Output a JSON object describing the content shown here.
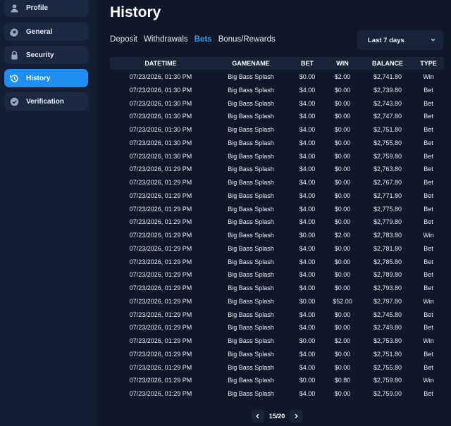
{
  "sidebar": {
    "items": [
      {
        "label": "Profile",
        "icon": "user-icon"
      },
      {
        "label": "General",
        "icon": "gear-icon"
      },
      {
        "label": "Security",
        "icon": "lock-icon"
      },
      {
        "label": "History",
        "icon": "history-icon",
        "active": true
      },
      {
        "label": "Verification",
        "icon": "check-badge-icon"
      }
    ]
  },
  "page": {
    "title": "History",
    "tabs": [
      "Deposit",
      "Withdrawals",
      "Bets",
      "Bonus/Rewards"
    ],
    "active_tab": "Bets",
    "range_select": "Last 7 days"
  },
  "table": {
    "headers": [
      "DATETIME",
      "GAMENAME",
      "BET",
      "WIN",
      "BALANCE",
      "TYPE"
    ],
    "rows": [
      [
        "07/23/2026, 01:30 PM",
        "Big Bass Splash",
        "$0.00",
        "$2.00",
        "$2,741.80",
        "Win"
      ],
      [
        "07/23/2026, 01:30 PM",
        "Big Bass Splash",
        "$4.00",
        "$0.00",
        "$2,739.80",
        "Bet"
      ],
      [
        "07/23/2026, 01:30 PM",
        "Big Bass Splash",
        "$4.00",
        "$0.00",
        "$2,743.80",
        "Bet"
      ],
      [
        "07/23/2026, 01:30 PM",
        "Big Bass Splash",
        "$4.00",
        "$0.00",
        "$2,747.80",
        "Bet"
      ],
      [
        "07/23/2026, 01:30 PM",
        "Big Bass Splash",
        "$4.00",
        "$0.00",
        "$2,751.80",
        "Bet"
      ],
      [
        "07/23/2026, 01:30 PM",
        "Big Bass Splash",
        "$4.00",
        "$0.00",
        "$2,755.80",
        "Bet"
      ],
      [
        "07/23/2026, 01:30 PM",
        "Big Bass Splash",
        "$4.00",
        "$0.00",
        "$2,759.80",
        "Bet"
      ],
      [
        "07/23/2026, 01:29 PM",
        "Big Bass Splash",
        "$4.00",
        "$0.00",
        "$2,763.80",
        "Bet"
      ],
      [
        "07/23/2026, 01:29 PM",
        "Big Bass Splash",
        "$4.00",
        "$0.00",
        "$2,767.80",
        "Bet"
      ],
      [
        "07/23/2026, 01:29 PM",
        "Big Bass Splash",
        "$4.00",
        "$0.00",
        "$2,771.80",
        "Bet"
      ],
      [
        "07/23/2026, 01:29 PM",
        "Big Bass Splash",
        "$4.00",
        "$0.00",
        "$2,775.80",
        "Bet"
      ],
      [
        "07/23/2026, 01:29 PM",
        "Big Bass Splash",
        "$4.00",
        "$0.00",
        "$2,779.80",
        "Bet"
      ],
      [
        "07/23/2026, 01:29 PM",
        "Big Bass Splash",
        "$0.00",
        "$2.00",
        "$2,783.80",
        "Win"
      ],
      [
        "07/23/2026, 01:29 PM",
        "Big Bass Splash",
        "$4.00",
        "$0.00",
        "$2,781.80",
        "Bet"
      ],
      [
        "07/23/2026, 01:29 PM",
        "Big Bass Splash",
        "$4.00",
        "$0.00",
        "$2,785.80",
        "Bet"
      ],
      [
        "07/23/2026, 01:29 PM",
        "Big Bass Splash",
        "$4.00",
        "$0.00",
        "$2,789.80",
        "Bet"
      ],
      [
        "07/23/2026, 01:29 PM",
        "Big Bass Splash",
        "$4.00",
        "$0.00",
        "$2,793.80",
        "Bet"
      ],
      [
        "07/23/2026, 01:29 PM",
        "Big Bass Splash",
        "$0.00",
        "$52.00",
        "$2,797.80",
        "Win"
      ],
      [
        "07/23/2026, 01:29 PM",
        "Big Bass Splash",
        "$4.00",
        "$0.00",
        "$2,745.80",
        "Bet"
      ],
      [
        "07/23/2026, 01:29 PM",
        "Big Bass Splash",
        "$4.00",
        "$0.00",
        "$2,749.80",
        "Bet"
      ],
      [
        "07/23/2026, 01:29 PM",
        "Big Bass Splash",
        "$0.00",
        "$2.00",
        "$2,753.80",
        "Win"
      ],
      [
        "07/23/2026, 01:29 PM",
        "Big Bass Splash",
        "$4.00",
        "$0.00",
        "$2,751.80",
        "Bet"
      ],
      [
        "07/23/2026, 01:29 PM",
        "Big Bass Splash",
        "$4.00",
        "$0.00",
        "$2,755.80",
        "Bet"
      ],
      [
        "07/23/2026, 01:29 PM",
        "Big Bass Splash",
        "$0.00",
        "$0.80",
        "$2,759.80",
        "Win"
      ],
      [
        "07/23/2026, 01:29 PM",
        "Big Bass Splash",
        "$4.00",
        "$0.00",
        "$2,759.00",
        "Bet"
      ]
    ]
  },
  "pagination": {
    "label": "15/20"
  },
  "colors": {
    "accent": "#1e8ff0",
    "background": "#0f1728",
    "sidebar": "#141d31"
  }
}
